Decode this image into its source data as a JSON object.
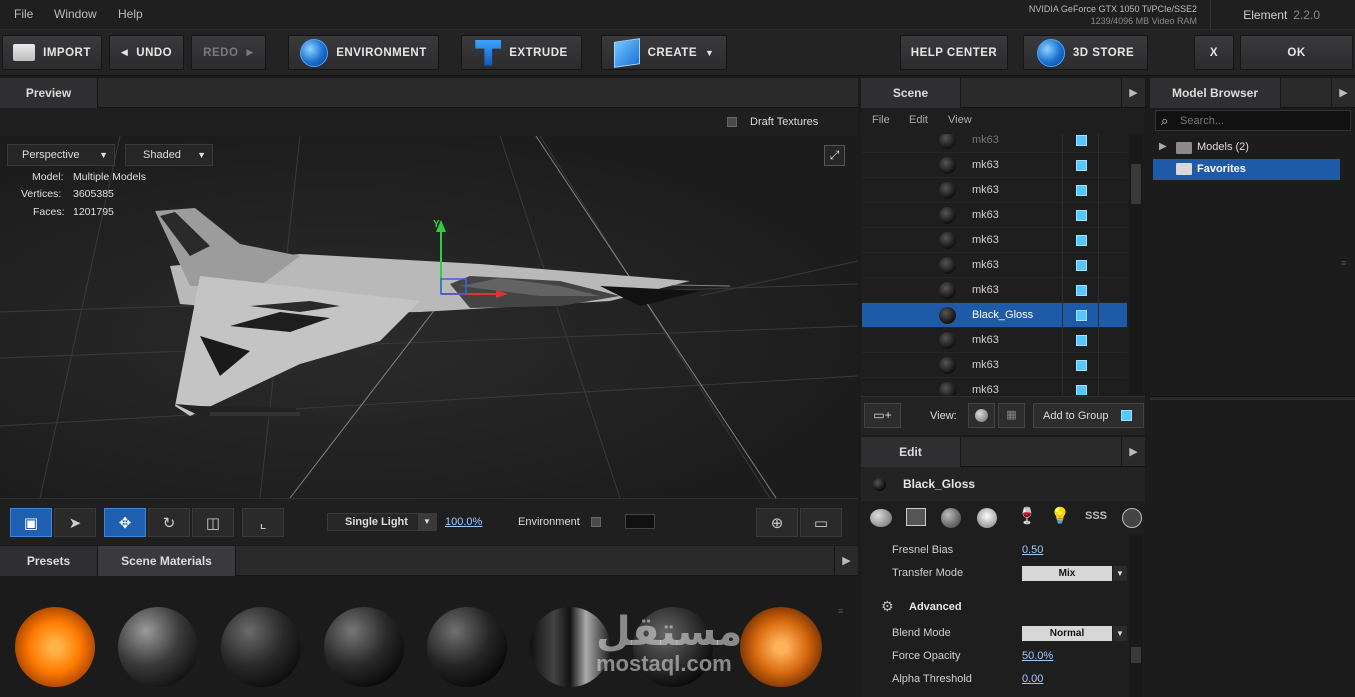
{
  "menubar": {
    "items": [
      "File",
      "Window",
      "Help"
    ],
    "gpu_line1": "NVIDIA GeForce GTX 1050 Ti/PCIe/SSE2",
    "gpu_line2": "1239/4096 MB Video RAM",
    "app_name": "Element",
    "app_version": "2.2.0"
  },
  "toolbar": {
    "import": "IMPORT",
    "undo": "UNDO",
    "redo": "REDO",
    "environment": "ENVIRONMENT",
    "extrude": "EXTRUDE",
    "create": "CREATE",
    "help_center": "HELP CENTER",
    "store": "3D STORE",
    "close": "X",
    "ok": "OK"
  },
  "preview": {
    "title": "Preview",
    "draft_textures": "Draft Textures",
    "camera_mode": "Perspective",
    "shading": "Shaded",
    "stats": {
      "model_label": "Model:",
      "model_value": "Multiple Models",
      "vertices_label": "Vertices:",
      "vertices_value": "3605385",
      "faces_label": "Faces:",
      "faces_value": "1201795"
    },
    "axis_y": "Y",
    "light_mode": "Single Light",
    "light_percent": "100.0%",
    "environment_label": "Environment"
  },
  "presets": {
    "tabs": [
      "Presets",
      "Scene Materials"
    ]
  },
  "scene": {
    "title": "Scene",
    "menu": [
      "File",
      "Edit",
      "View"
    ],
    "rows": [
      "mk63",
      "mk63",
      "mk63",
      "mk63",
      "mk63",
      "mk63",
      "mk63",
      "Black_Gloss",
      "mk63",
      "mk63",
      "mk63"
    ],
    "selected_index": 7,
    "view_label": "View:",
    "add_to_group": "Add to Group"
  },
  "browser": {
    "title": "Model Browser",
    "search_placeholder": "Search...",
    "tree": [
      {
        "label": "Models (2)"
      },
      {
        "label": "Favorites"
      }
    ]
  },
  "edit": {
    "title": "Edit",
    "material_name": "Black_Gloss",
    "props": {
      "fresnel_bias_label": "Fresnel Bias",
      "fresnel_bias_value": "0.50",
      "transfer_mode_label": "Transfer Mode",
      "transfer_mode_value": "Mix",
      "advanced_label": "Advanced",
      "blend_mode_label": "Blend Mode",
      "blend_mode_value": "Normal",
      "force_opacity_label": "Force Opacity",
      "force_opacity_value": "50.0%",
      "alpha_threshold_label": "Alpha Threshold",
      "alpha_threshold_value": "0.00"
    },
    "sss_label": "SSS"
  },
  "watermark": {
    "arabic": "مستقل",
    "latin": "mostaql.com"
  },
  "colors": {
    "accent_blue": "#1f5aa8",
    "vis_blue": "#55c8ff",
    "panel_bg": "#1e1e1f"
  }
}
